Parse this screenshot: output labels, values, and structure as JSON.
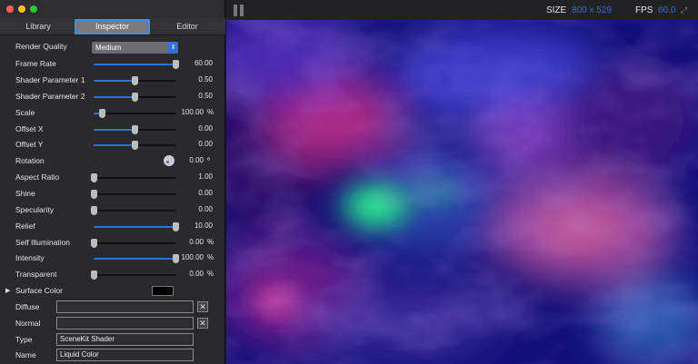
{
  "window": {
    "traffic_lights": [
      "#fe5f57",
      "#febc2e",
      "#28c840"
    ]
  },
  "tabs": [
    {
      "label": "Library",
      "active": false
    },
    {
      "label": "Inspector",
      "active": true
    },
    {
      "label": "Editor",
      "active": false
    }
  ],
  "inspector": {
    "render_quality": {
      "label": "Render Quality",
      "value": "Medium"
    },
    "frame_rate": {
      "label": "Frame Rate",
      "value": "60.00",
      "level": 1.0
    },
    "shader_param_1": {
      "label": "Shader Parameter 1",
      "value": "0.50",
      "level": 0.5
    },
    "shader_param_2": {
      "label": "Shader Parameter 2",
      "value": "0.50",
      "level": 0.5
    },
    "scale": {
      "label": "Scale",
      "value": "100.00",
      "unit": "%",
      "level": 0.1
    },
    "offset_x": {
      "label": "Offset X",
      "value": "0.00",
      "level": 0.5
    },
    "offset_y": {
      "label": "Offset Y",
      "value": "0.00",
      "level": 0.5
    },
    "rotation": {
      "label": "Rotation",
      "value": "0.00",
      "unit": "º"
    },
    "aspect_ratio": {
      "label": "Aspect Ratio",
      "value": "1.00",
      "level": 0.0
    },
    "shine": {
      "label": "Shine",
      "value": "0.00",
      "level": 0.0
    },
    "specularity": {
      "label": "Specularity",
      "value": "0.00",
      "level": 0.0
    },
    "relief": {
      "label": "Relief",
      "value": "10.00",
      "level": 1.0
    },
    "self_illumination": {
      "label": "Self Illumination",
      "value": "0.00",
      "unit": "%",
      "level": 0.0
    },
    "intensity": {
      "label": "Intensity",
      "value": "100.00",
      "unit": "%",
      "level": 1.0
    },
    "transparent": {
      "label": "Transparent",
      "value": "0.00",
      "unit": "%",
      "level": 0.0
    },
    "surface_color": {
      "label": "Surface Color",
      "color": "#000000"
    },
    "diffuse": {
      "label": "Diffuse",
      "value": ""
    },
    "normal": {
      "label": "Normal",
      "value": ""
    },
    "type": {
      "label": "Type",
      "value": "SceneKit Shader"
    },
    "name": {
      "label": "Name",
      "value": "Liquid Color"
    }
  },
  "viewport": {
    "size_label": "SIZE",
    "size_value": "800 x 529",
    "fps_label": "FPS",
    "fps_value": "60.0",
    "accent": "#3f6ac8"
  }
}
